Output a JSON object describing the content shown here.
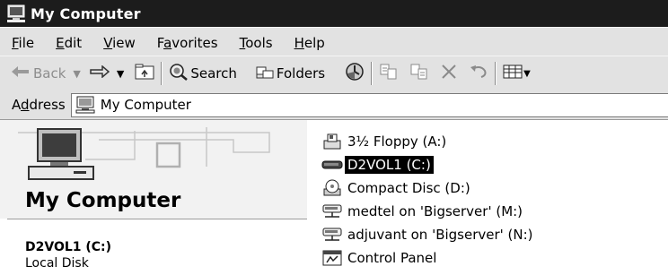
{
  "window": {
    "title": "My Computer"
  },
  "menu": [
    {
      "label": "File",
      "hotkey": "F",
      "rest": "ile"
    },
    {
      "label": "Edit",
      "hotkey": "E",
      "rest": "dit"
    },
    {
      "label": "View",
      "hotkey": "V",
      "rest": "iew"
    },
    {
      "label": "Favorites",
      "pre": "F",
      "hotkey": "a",
      "rest": "vorites"
    },
    {
      "label": "Tools",
      "hotkey": "T",
      "rest": "ools"
    },
    {
      "label": "Help",
      "hotkey": "H",
      "rest": "elp"
    }
  ],
  "toolbar": {
    "back_label": "Back",
    "search_label": "Search",
    "folders_label": "Folders"
  },
  "address": {
    "label_pre": "A",
    "label_hot": "d",
    "label_rest": "dress",
    "value": "My Computer"
  },
  "left_panel": {
    "title": "My Computer",
    "drive_name": "D2VOL1 (C:)",
    "drive_type": "Local Disk"
  },
  "items": [
    {
      "label": "3½ Floppy (A:)",
      "icon": "floppy-icon",
      "selected": false
    },
    {
      "label": "D2VOL1 (C:)",
      "icon": "hard-disk-icon",
      "selected": true
    },
    {
      "label": "Compact Disc (D:)",
      "icon": "cd-icon",
      "selected": false
    },
    {
      "label": "medtel on 'Bigserver' (M:)",
      "icon": "network-drive-icon",
      "selected": false
    },
    {
      "label": "adjuvant on 'Bigserver' (N:)",
      "icon": "network-drive-icon",
      "selected": false
    },
    {
      "label": "Control Panel",
      "icon": "control-panel-icon",
      "selected": false
    }
  ]
}
